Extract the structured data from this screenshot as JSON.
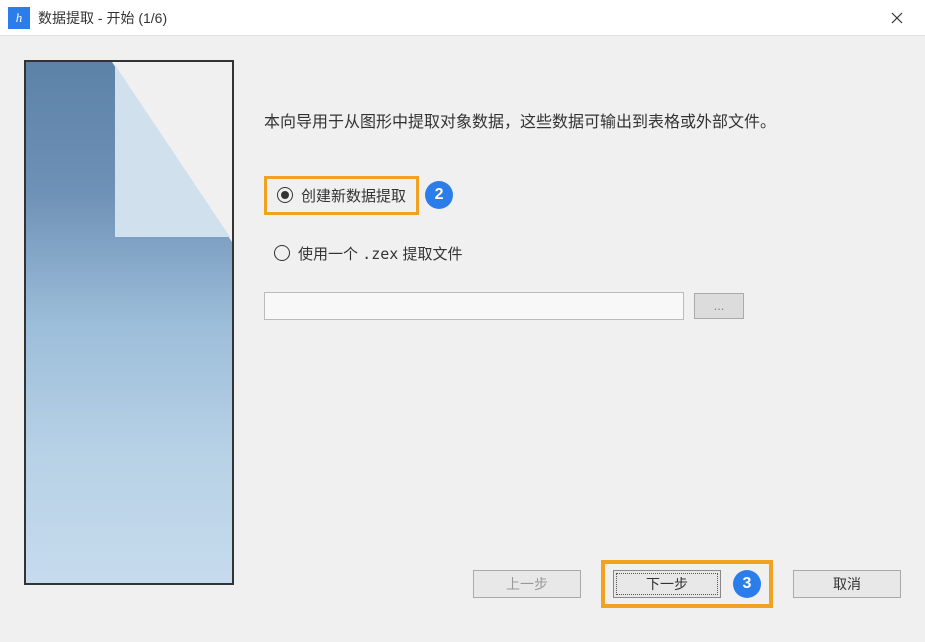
{
  "window": {
    "title": "数据提取 - 开始 (1/6)",
    "icon_label": "h"
  },
  "intro": "本向导用于从图形中提取对象数据，这些数据可输出到表格或外部文件。",
  "options": {
    "create_new": "创建新数据提取",
    "use_file_prefix": "使用一个 ",
    "use_file_ext": ".zex",
    "use_file_suffix": " 提取文件",
    "file_value": "",
    "browse_label": "..."
  },
  "buttons": {
    "prev": "上一步",
    "next": "下一步",
    "cancel": "取消"
  },
  "annotations": {
    "step2": "2",
    "step3": "3"
  }
}
